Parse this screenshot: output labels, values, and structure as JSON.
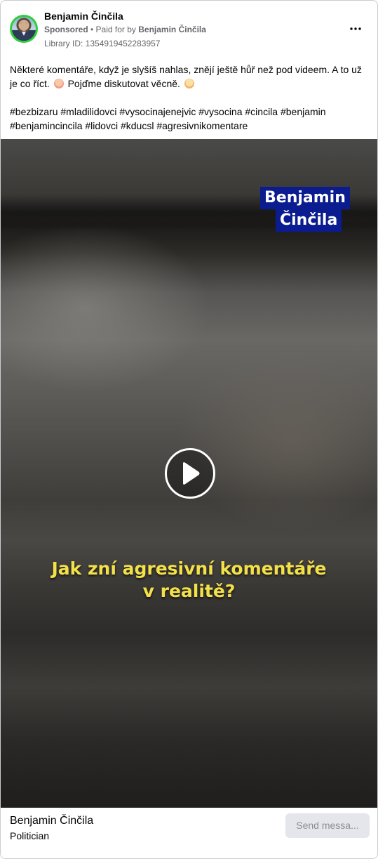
{
  "header": {
    "page_name": "Benjamin Činčila",
    "sponsored": "Sponsored",
    "separator": " • ",
    "paid_for_prefix": "Paid for by ",
    "paid_for_by": "Benjamin Činčila",
    "library_id": "Library ID: 1354919452283957",
    "more_icon": "more-horizontal-icon"
  },
  "post": {
    "text_line1": "Některé komentáře, když je slyšíš nahlas, znějí ještě hůř než pod videem. A to už je co říct.",
    "text_line2": "Pojďme diskutovat věcně.",
    "hashtags": "#bezbizaru #mladilidovci #vysocinajenejvic #vysocina #cincila #benjamin #benjamincincila #lidovci #kducsl #agresivnikomentare"
  },
  "video": {
    "name_tag_line1": "Benjamin",
    "name_tag_line2": "Činčila",
    "caption_line1": "Jak zní agresivní komentáře",
    "caption_line2": "v realitě?",
    "play_icon": "play-icon"
  },
  "footer": {
    "name": "Benjamin Činčila",
    "category": "Politician",
    "send_button": "Send messa..."
  },
  "colors": {
    "avatar_ring": "#2fcf3a",
    "name_tag_bg": "#0a1c8f",
    "caption": "#f3e14a",
    "secondary_text": "#65676b"
  }
}
